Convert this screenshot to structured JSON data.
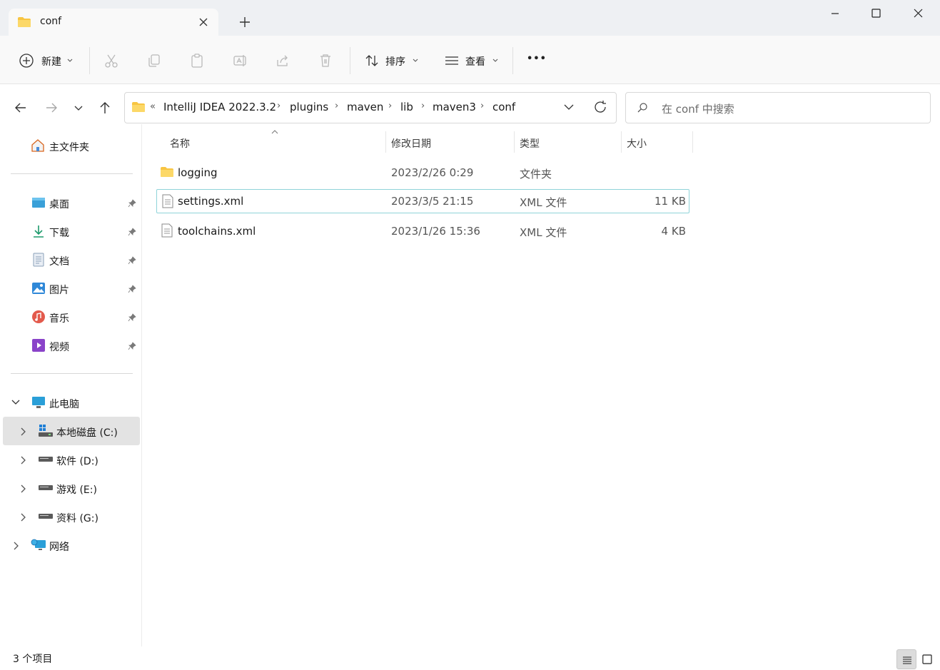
{
  "tab": {
    "title": "conf"
  },
  "toolbar": {
    "new_label": "新建",
    "sort_label": "排序",
    "view_label": "查看",
    "more_label": "•••"
  },
  "breadcrumb": {
    "overflow": "«",
    "items": [
      "IntelliJ IDEA 2022.3.2",
      "plugins",
      "maven",
      "lib",
      "maven3",
      "conf"
    ]
  },
  "search": {
    "placeholder": "在 conf 中搜索"
  },
  "sidebar": {
    "home": "主文件夹",
    "quick": [
      "桌面",
      "下载",
      "文档",
      "图片",
      "音乐",
      "视频"
    ],
    "this_pc": "此电脑",
    "drives": [
      "本地磁盘 (C:)",
      "软件 (D:)",
      "游戏 (E:)",
      "资料 (G:)"
    ],
    "network": "网络"
  },
  "columns": {
    "name": "名称",
    "date": "修改日期",
    "type": "类型",
    "size": "大小"
  },
  "files": [
    {
      "name": "logging",
      "date": "2023/2/26 0:29",
      "type": "文件夹",
      "size": ""
    },
    {
      "name": "settings.xml",
      "date": "2023/3/5 21:15",
      "type": "XML 文件",
      "size": "11 KB"
    },
    {
      "name": "toolchains.xml",
      "date": "2023/1/26 15:36",
      "type": "XML 文件",
      "size": "4 KB"
    }
  ],
  "status": {
    "count": "3 个项目"
  },
  "colors": {
    "accent": "#0067c0",
    "folder": "#f8c542",
    "selection_border": "#8fd3d9"
  }
}
